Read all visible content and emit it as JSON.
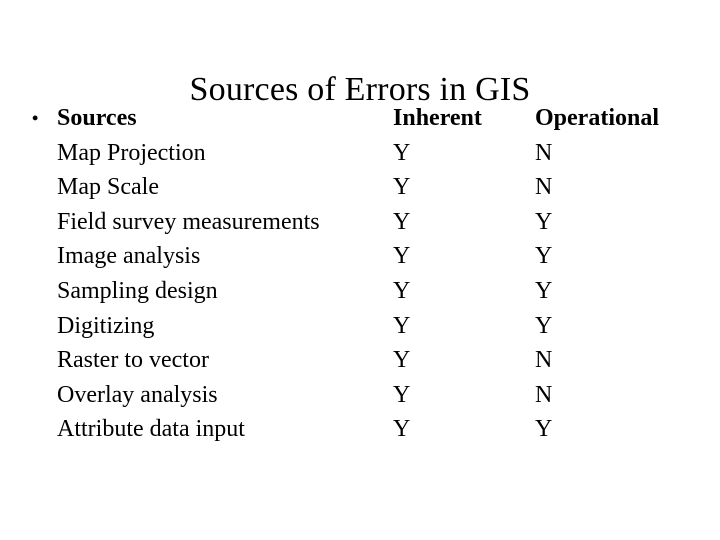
{
  "slide": {
    "title": "Sources of Errors in GIS",
    "background_color": "#ffffff",
    "text_color": "#000000"
  },
  "bullet": {
    "glyph": "•"
  },
  "table": {
    "headers": {
      "sources": "Sources",
      "inherent": "Inherent",
      "operational": "Operational"
    },
    "rows": [
      {
        "source": "Map Projection",
        "inherent": "Y",
        "operational": "N"
      },
      {
        "source": "Map Scale",
        "inherent": "Y",
        "operational": "N"
      },
      {
        "source": "Field survey measurements",
        "inherent": "Y",
        "operational": "Y"
      },
      {
        "source": "Image analysis",
        "inherent": "Y",
        "operational": "Y"
      },
      {
        "source": "Sampling design",
        "inherent": "Y",
        "operational": "Y"
      },
      {
        "source": "Digitizing",
        "inherent": "Y",
        "operational": "Y"
      },
      {
        "source": "Raster to vector",
        "inherent": "Y",
        "operational": "N"
      },
      {
        "source": "Overlay analysis",
        "inherent": "Y",
        "operational": "N"
      },
      {
        "source": "Attribute data input",
        "inherent": "Y",
        "operational": "Y"
      }
    ]
  }
}
